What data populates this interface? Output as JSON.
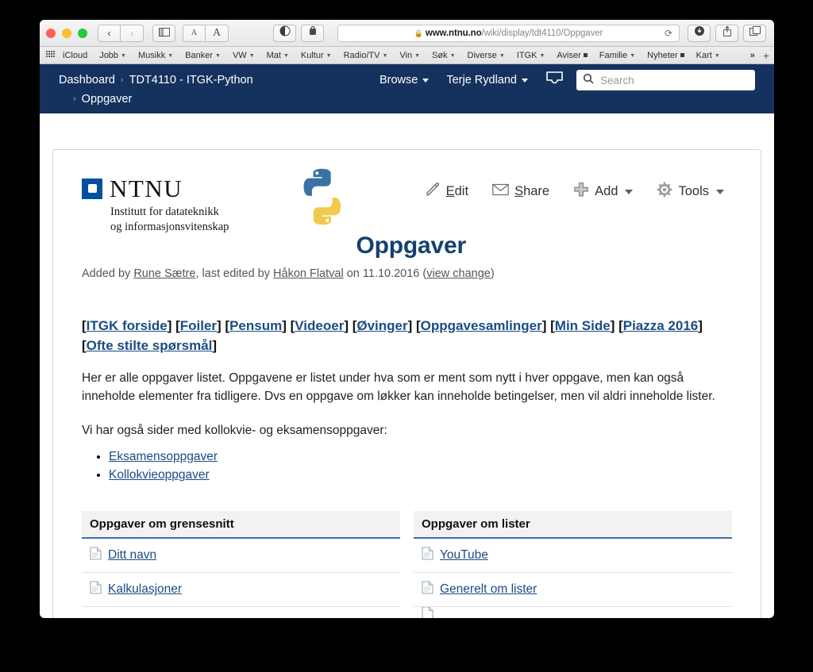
{
  "browser": {
    "traffic_lights": [
      "close",
      "minimize",
      "maximize"
    ],
    "nav_back": "‹",
    "nav_forward": "›",
    "sidebar_icon": "sidebar-icon",
    "font_small": "A",
    "font_large": "A",
    "reader_icon": "reader-icon",
    "privacy_icon": "privacy-report-icon",
    "url": {
      "lock": "🔒",
      "host": "www.ntnu.no",
      "path": "/wiki/display/tdt4110/Oppgaver"
    },
    "reload": "⟳",
    "download_icon": "download-icon",
    "share_icon": "share-icon",
    "tabs_icon": "tab-overview-icon",
    "bookmarks": [
      {
        "label": "iCloud",
        "marker": "none"
      },
      {
        "label": "Jobb",
        "marker": "chevron"
      },
      {
        "label": "Musikk",
        "marker": "chevron"
      },
      {
        "label": "Banker",
        "marker": "chevron"
      },
      {
        "label": "VW",
        "marker": "chevron"
      },
      {
        "label": "Mat",
        "marker": "chevron"
      },
      {
        "label": "Kultur",
        "marker": "chevron"
      },
      {
        "label": "Radio/TV",
        "marker": "chevron"
      },
      {
        "label": "Vin",
        "marker": "chevron"
      },
      {
        "label": "Søk",
        "marker": "chevron"
      },
      {
        "label": "Diverse",
        "marker": "chevron"
      },
      {
        "label": "ITGK",
        "marker": "chevron"
      },
      {
        "label": "Aviser",
        "marker": "square"
      },
      {
        "label": "Familie",
        "marker": "chevron"
      },
      {
        "label": "Nyheter",
        "marker": "square"
      },
      {
        "label": "Kart",
        "marker": "chevron"
      }
    ],
    "bookmarks_overflow": "»",
    "bookmarks_add": "+"
  },
  "confluence": {
    "breadcrumb_dashboard": "Dashboard",
    "breadcrumb_space": "TDT4110 - ITGK-Python",
    "breadcrumb_page": "Oppgaver",
    "separator": "›",
    "browse_label": "Browse",
    "user_label": "Terje Rydland",
    "inbox_icon": "inbox-icon",
    "search_placeholder": "Search",
    "search_icon": "search-icon",
    "header_color": "#15325f"
  },
  "page": {
    "logo": {
      "ntnu_word": "NTNU",
      "ntnu_sub_line1": "Institutt for datateknikk",
      "ntnu_sub_line2": "og informasjonsvitenskap",
      "python_logo": "python-logo"
    },
    "actions": [
      {
        "name": "edit",
        "icon": "pencil-icon",
        "accesskey": "E",
        "rest": "dit",
        "has_caret": false
      },
      {
        "name": "share",
        "icon": "envelope-icon",
        "accesskey": "S",
        "rest": "hare",
        "has_caret": false
      },
      {
        "name": "add",
        "icon": "plus-icon",
        "accesskey": "",
        "rest": "Add",
        "has_caret": true
      },
      {
        "name": "tools",
        "icon": "gear-icon",
        "accesskey": "",
        "rest": "Tools",
        "has_caret": true
      }
    ],
    "title": "Oppgaver",
    "title_color": "#14416f",
    "byline": {
      "added_by_prefix": "Added by ",
      "author": "Rune Sætre",
      "mid": ", last edited by ",
      "editor": "Håkon Flatval",
      "on": " on ",
      "date": "11.10.2016",
      "view_change_open": "  (",
      "view_change": "view change",
      "view_change_close": ")"
    },
    "linkbar": [
      "ITGK forside",
      "Foiler",
      "Pensum",
      "Videoer",
      "Øvinger",
      "Oppgavesamlinger",
      "Min Side",
      "Piazza 2016",
      "Ofte stilte spørsmål"
    ],
    "paragraph1": "Her er alle oppgaver listet. Oppgavene er listet under hva som er ment som nytt i hver oppgave, men kan også inneholde elementer fra tidligere. Dvs en oppgave om løkker kan inneholde betingelser, men vil aldri inneholde lister.",
    "paragraph2": "Vi har også sider med kollokvie- og eksamensoppgaver:",
    "bullets": [
      "Eksamensoppgaver",
      "Kollokvieoppgaver"
    ],
    "tables": [
      {
        "header": "Oppgaver om grensesnitt",
        "rows": [
          "Ditt navn",
          "Kalkulasjoner"
        ]
      },
      {
        "header": "Oppgaver om lister",
        "rows": [
          "YouTube",
          "Generelt om lister"
        ]
      }
    ]
  }
}
